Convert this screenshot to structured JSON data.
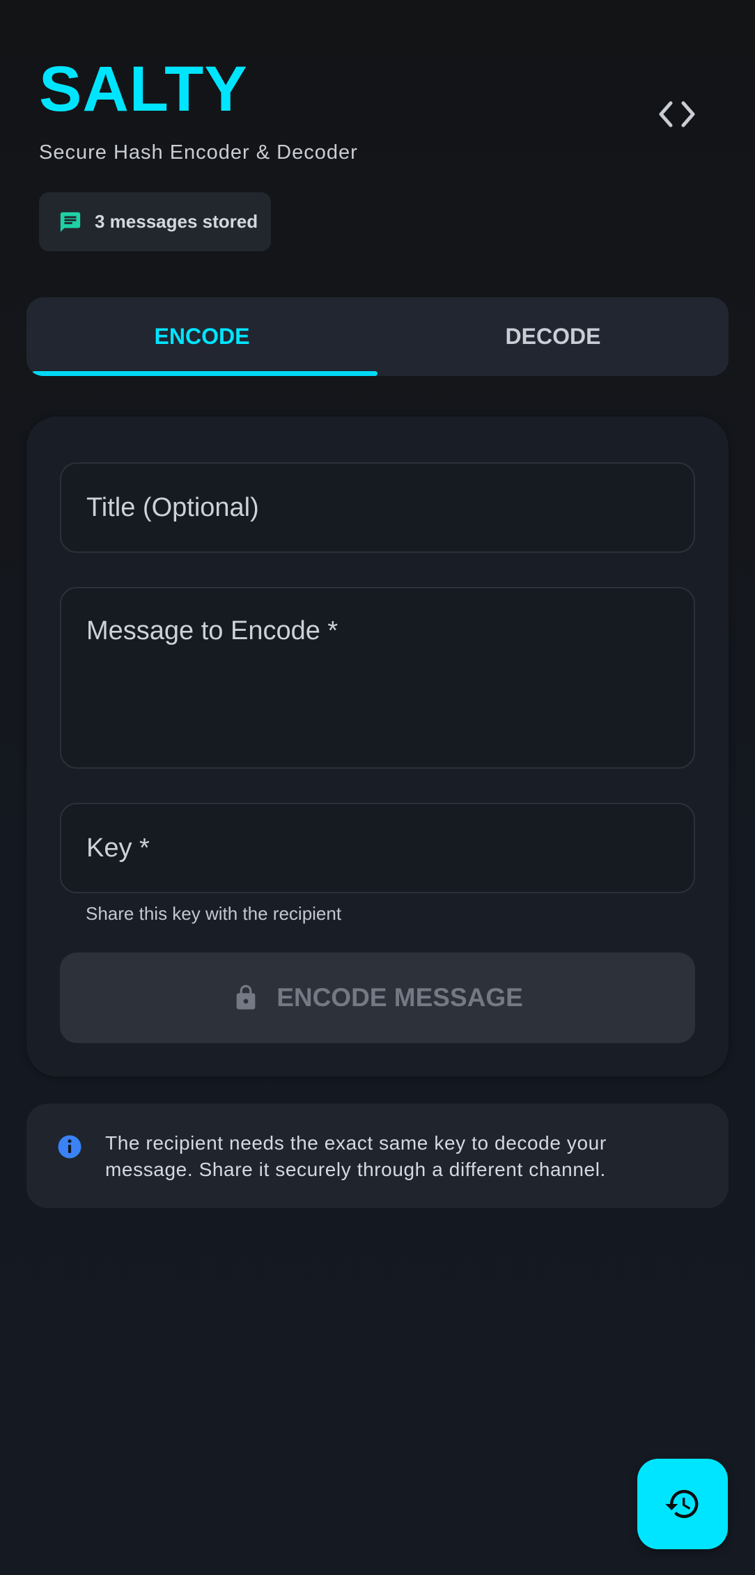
{
  "header": {
    "title": "SALTY",
    "subtitle": "Secure Hash Encoder & Decoder",
    "code_icon": "code-brackets-icon"
  },
  "stored_badge": {
    "icon": "chat-message-icon",
    "label": "3 messages stored",
    "count": 3
  },
  "tabs": [
    {
      "label": "ENCODE",
      "active": true
    },
    {
      "label": "DECODE",
      "active": false
    }
  ],
  "form": {
    "title_field": {
      "placeholder": "Title (Optional)",
      "value": ""
    },
    "message_field": {
      "placeholder": "Message to Encode *",
      "value": ""
    },
    "key_field": {
      "placeholder": "Key *",
      "value": "",
      "helper": "Share this key with the recipient"
    },
    "submit": {
      "label": "ENCODE MESSAGE",
      "icon": "lock-icon",
      "enabled": false
    }
  },
  "info": {
    "icon": "info-icon",
    "text": "The recipient needs the exact same key to decode your message. Share it securely through a different channel."
  },
  "fab": {
    "icon": "history-icon"
  },
  "colors": {
    "accent": "#00e5ff",
    "badge_icon": "#1fd1a5",
    "info_icon": "#3b82f6",
    "background": "#141820"
  }
}
